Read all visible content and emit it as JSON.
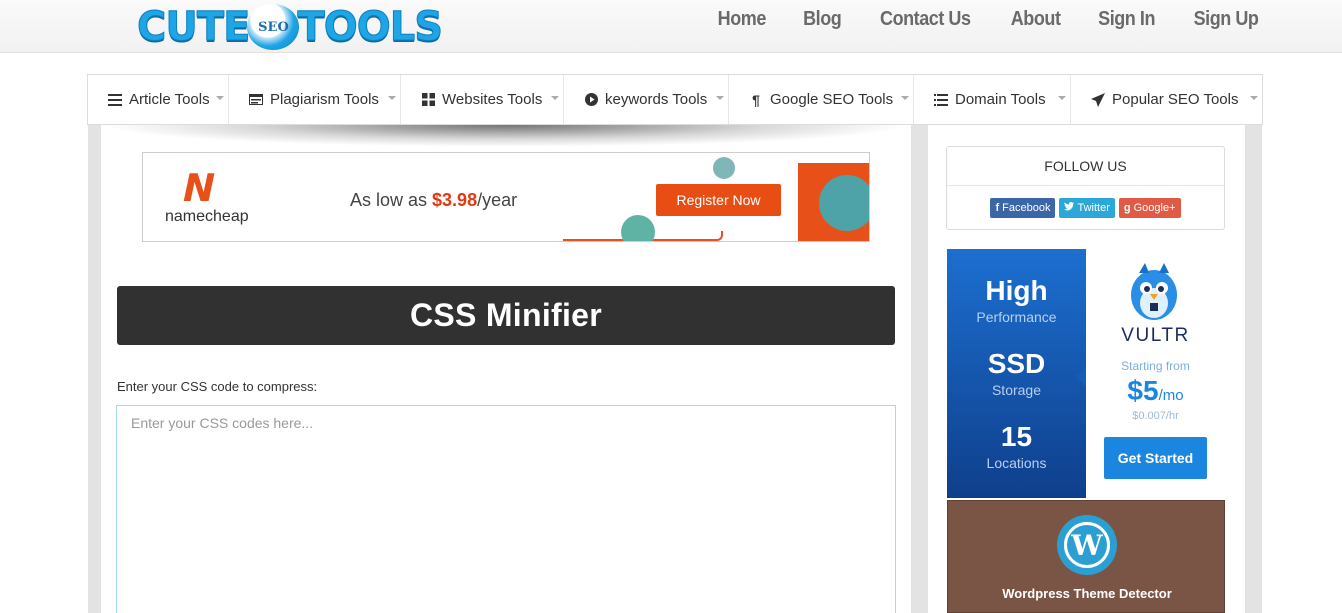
{
  "header": {
    "logo": {
      "left": "CUTE",
      "badge": "SEO",
      "right": "TOOLS"
    },
    "nav": [
      "Home",
      "Blog",
      "Contact Us",
      "About",
      "Sign In",
      "Sign Up"
    ]
  },
  "toolmenu": {
    "items": [
      {
        "label": "Article Tools",
        "icon": "list-icon"
      },
      {
        "label": "Plagiarism Tools",
        "icon": "card-icon"
      },
      {
        "label": "Websites Tools",
        "icon": "grid-icon"
      },
      {
        "label": "keywords Tools",
        "icon": "play-circle-icon"
      },
      {
        "label": "Google SEO Tools",
        "icon": "paragraph-icon"
      },
      {
        "label": "Domain Tools",
        "icon": "list-icon"
      },
      {
        "label": "Popular SEO Tools",
        "icon": "send-icon"
      }
    ]
  },
  "banner_ad": {
    "brand": "namecheap",
    "text_prefix": "As low as ",
    "price": "$3.98",
    "text_suffix": "/year",
    "cta": "Register Now"
  },
  "main": {
    "title": "CSS Minifier",
    "prompt": "Enter your CSS code to compress:",
    "input_placeholder": "Enter your CSS codes here...",
    "input_value": ""
  },
  "sidebar": {
    "follow": {
      "heading": "FOLLOW US",
      "facebook": "Facebook",
      "twitter": "Twitter",
      "googleplus": "Google+"
    },
    "vultr_ad": {
      "line1_big": "High",
      "line1_small": "Performance",
      "line2_big": "SSD",
      "line2_small": "Storage",
      "line3_big": "15",
      "line3_small": "Locations",
      "brand": "VULTR",
      "starting_from": "Starting from",
      "price": "$5",
      "per": "/mo",
      "hourly": "$0.007/hr",
      "cta": "Get Started"
    },
    "wp_detector": {
      "title": "Wordpress Theme Detector"
    }
  },
  "colors": {
    "brand_blue": "#1ea5e6",
    "title_bar": "#313131",
    "namecheap_orange": "#e84e14",
    "vultr_blue": "#1a86e0",
    "wp_brown": "#7a5546"
  }
}
